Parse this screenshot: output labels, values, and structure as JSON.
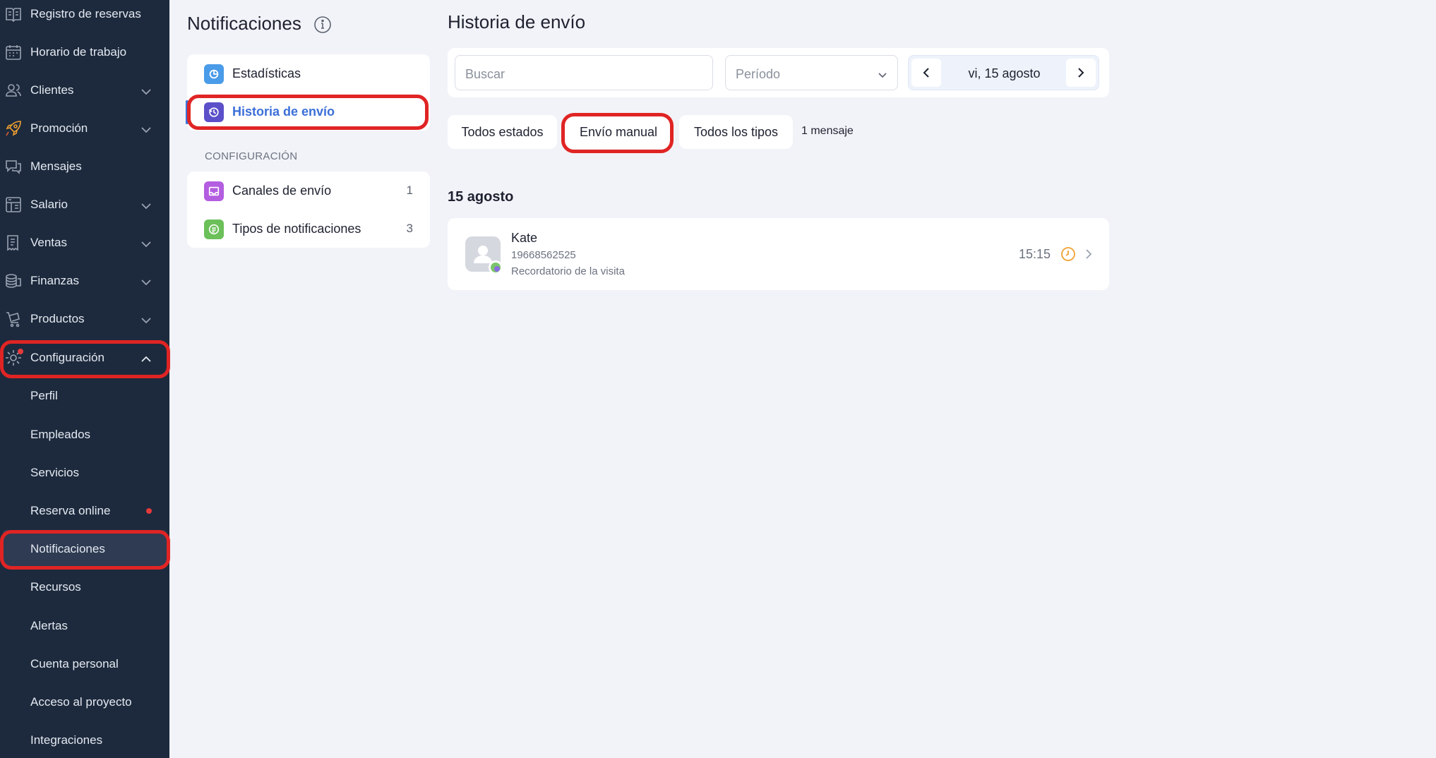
{
  "sidebar": {
    "items": [
      {
        "label": "Registro de reservas",
        "icon": "book-icon"
      },
      {
        "label": "Horario de trabajo",
        "icon": "calendar-icon"
      },
      {
        "label": "Clientes",
        "icon": "users-icon"
      },
      {
        "label": "Promoción",
        "icon": "rocket-icon"
      },
      {
        "label": "Mensajes",
        "icon": "chat-icon"
      },
      {
        "label": "Salario",
        "icon": "calculator-icon"
      },
      {
        "label": "Ventas",
        "icon": "receipt-icon"
      },
      {
        "label": "Finanzas",
        "icon": "coins-icon"
      },
      {
        "label": "Productos",
        "icon": "cart-icon"
      },
      {
        "label": "Configuración",
        "icon": "gear-icon"
      }
    ],
    "sub_items": [
      {
        "label": "Perfil"
      },
      {
        "label": "Empleados"
      },
      {
        "label": "Servicios"
      },
      {
        "label": "Reserva online"
      },
      {
        "label": "Notificaciones"
      },
      {
        "label": "Recursos"
      },
      {
        "label": "Alertas"
      },
      {
        "label": "Cuenta personal"
      },
      {
        "label": "Acceso al proyecto"
      },
      {
        "label": "Integraciones"
      }
    ]
  },
  "notifications_panel": {
    "title": "Notificaciones",
    "menu": [
      {
        "label": "Estadísticas",
        "icon": "chart-icon"
      },
      {
        "label": "Historia de envío",
        "icon": "history-icon"
      }
    ],
    "config_section": "CONFIGURACIÓN",
    "config_items": [
      {
        "label": "Canales de envío",
        "count": "1",
        "icon": "mail-icon"
      },
      {
        "label": "Tipos de notificaciones",
        "count": "3",
        "icon": "list-icon"
      }
    ]
  },
  "main": {
    "title": "Historia de envío",
    "search_placeholder": "Buscar",
    "period_placeholder": "Período",
    "date": "vi, 15 agosto",
    "chips": [
      "Todos estados",
      "Envío manual",
      "Todos los tipos"
    ],
    "message_count": "1 mensaje",
    "date_heading": "15 agosto",
    "message": {
      "name": "Kate",
      "phone": "19668562525",
      "type": "Recordatorio de la visita",
      "time": "15:15"
    }
  },
  "colors": {
    "sidebar_bg": "#1d2a3d",
    "accent": "#3b6fd8",
    "highlight": "#e02424",
    "clock": "#f0a030"
  }
}
